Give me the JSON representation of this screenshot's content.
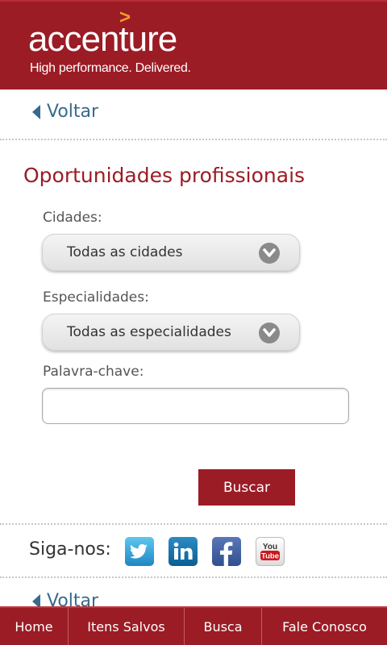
{
  "header": {
    "logo_text": "accenture",
    "logo_mark": ">",
    "tagline": "High performance. Delivered."
  },
  "back_label": "Voltar",
  "page_title": "Oportunidades profissionais",
  "form": {
    "cities_label": "Cidades:",
    "cities_value": "Todas as cidades",
    "specialties_label": "Especialidades:",
    "specialties_value": "Todas as especialidades",
    "keyword_label": "Palavra-chave:",
    "keyword_value": "",
    "search_button": "Buscar"
  },
  "social": {
    "label": "Siga-nos:",
    "icons": [
      "twitter-icon",
      "linkedin-icon",
      "facebook-icon",
      "youtube-icon"
    ],
    "youtube_text_top": "You",
    "youtube_text_bottom": "Tube"
  },
  "bottom_nav": [
    "Home",
    "Itens Salvos",
    "Busca",
    "Fale Conosco"
  ],
  "colors": {
    "brand": "#9b1c25",
    "accent": "#f39c2a",
    "link": "#376b8c"
  }
}
